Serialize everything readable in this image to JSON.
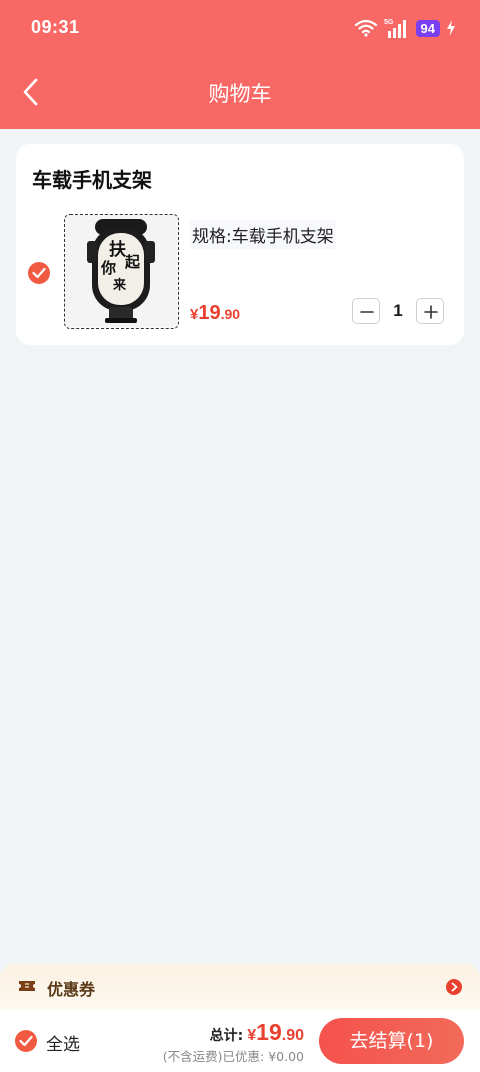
{
  "status_bar": {
    "time": "09:31",
    "network": "5G",
    "battery": "94"
  },
  "nav": {
    "title": "购物车",
    "back_icon": "chevron-left-icon"
  },
  "cart": {
    "shop_name": "车载手机支架",
    "items": [
      {
        "checked": true,
        "image_text": "扶你起来",
        "spec": "规格:车载手机支架",
        "price_symbol": "¥",
        "price_int": "19",
        "price_dec": ".90",
        "quantity": "1"
      }
    ]
  },
  "coupon": {
    "label": "优惠券",
    "icon": "ticket-icon"
  },
  "footer": {
    "select_all_label": "全选",
    "total_label": "总计:",
    "total_symbol": "¥",
    "total_int": "19",
    "total_dec": ".90",
    "note": "(不含运费)已优惠: ¥0.00",
    "checkout_label": "去结算(1)"
  },
  "colors": {
    "header": "#f86966",
    "accent": "#e8412f",
    "checkbox": "#f05a42",
    "background": "#f1f4f6"
  }
}
